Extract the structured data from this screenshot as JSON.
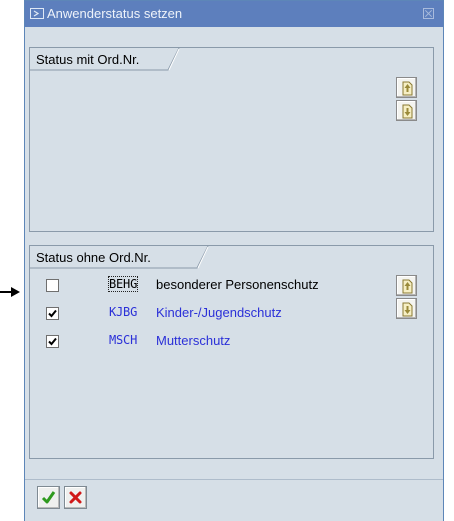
{
  "window": {
    "title": "Anwenderstatus setzen"
  },
  "group_with_number": {
    "label": "Status mit Ord.Nr."
  },
  "group_without_number": {
    "label": "Status ohne Ord.Nr.",
    "rows": [
      {
        "checked": false,
        "code": "BEHG",
        "description": "besonderer Personenschutz"
      },
      {
        "checked": true,
        "code": "KJBG",
        "description": "Kinder-/Jugendschutz"
      },
      {
        "checked": true,
        "code": "MSCH",
        "description": "Mutterschutz"
      }
    ]
  },
  "buttons": {
    "move_up_icon": "page-up-icon",
    "move_down_icon": "page-down-icon",
    "confirm_icon": "checkmark-icon",
    "cancel_icon": "x-icon"
  },
  "colors": {
    "titlebar": "#5d7fbd",
    "dialog_background": "#d6dfe7",
    "active_status_text": "#2b30d8",
    "confirm": "#2f9a1e",
    "cancel": "#d01818"
  }
}
